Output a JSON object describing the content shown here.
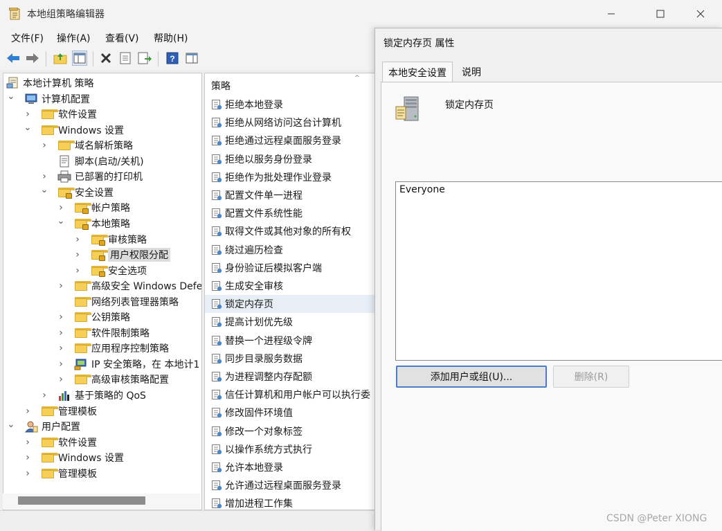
{
  "window": {
    "title": "本地组策略编辑器",
    "minimize_glyph": "—",
    "maximize_glyph": "☐",
    "close_glyph": "✕"
  },
  "menu": [
    "文件(F)",
    "操作(A)",
    "查看(V)",
    "帮助(H)"
  ],
  "toolbar": {
    "icons": [
      "back-arrow-icon",
      "forward-arrow-icon",
      "up-folder-icon",
      "show-hide-tree-icon",
      "delete-icon",
      "properties-icon",
      "export-list-icon",
      "help-icon",
      "action-pane-icon"
    ]
  },
  "tree": {
    "items": [
      {
        "label": "本地计算机 策略",
        "icon": "computer-policy-icon",
        "level": 0,
        "expander": ""
      },
      {
        "label": "计算机配置",
        "icon": "computer-icon",
        "level": 1,
        "expander": "expanded"
      },
      {
        "label": "软件设置",
        "icon": "folder-icon",
        "level": 2,
        "expander": "collapsed"
      },
      {
        "label": "Windows 设置",
        "icon": "folder-icon",
        "level": 2,
        "expander": "expanded"
      },
      {
        "label": "域名解析策略",
        "icon": "folder-icon",
        "level": 3,
        "expander": "collapsed"
      },
      {
        "label": "脚本(启动/关机)",
        "icon": "script-icon",
        "level": 3,
        "expander": ""
      },
      {
        "label": "已部署的打印机",
        "icon": "printer-icon",
        "level": 3,
        "expander": "collapsed"
      },
      {
        "label": "安全设置",
        "icon": "security-folder-icon",
        "level": 3,
        "expander": "expanded"
      },
      {
        "label": "帐户策略",
        "icon": "security-folder-icon",
        "level": 4,
        "expander": "collapsed"
      },
      {
        "label": "本地策略",
        "icon": "security-folder-icon",
        "level": 4,
        "expander": "expanded"
      },
      {
        "label": "审核策略",
        "icon": "security-folder-icon",
        "level": 5,
        "expander": "collapsed"
      },
      {
        "label": "用户权限分配",
        "icon": "security-folder-icon",
        "level": 5,
        "expander": "collapsed",
        "selected": true
      },
      {
        "label": "安全选项",
        "icon": "security-folder-icon",
        "level": 5,
        "expander": "collapsed"
      },
      {
        "label": "高级安全 Windows Defe",
        "icon": "folder-icon",
        "level": 4,
        "expander": "collapsed"
      },
      {
        "label": "网络列表管理器策略",
        "icon": "folder-icon",
        "level": 4,
        "expander": ""
      },
      {
        "label": "公钥策略",
        "icon": "folder-icon",
        "level": 4,
        "expander": "collapsed"
      },
      {
        "label": "软件限制策略",
        "icon": "folder-icon",
        "level": 4,
        "expander": "collapsed"
      },
      {
        "label": "应用程序控制策略",
        "icon": "folder-icon",
        "level": 4,
        "expander": "collapsed"
      },
      {
        "label": "IP 安全策略，在 本地计1",
        "icon": "ip-security-icon",
        "level": 4,
        "expander": "collapsed"
      },
      {
        "label": "高级审核策略配置",
        "icon": "folder-icon",
        "level": 4,
        "expander": "collapsed"
      },
      {
        "label": "基于策略的 QoS",
        "icon": "qos-chart-icon",
        "level": 3,
        "expander": "collapsed"
      },
      {
        "label": "管理模板",
        "icon": "folder-icon",
        "level": 2,
        "expander": "collapsed"
      },
      {
        "label": "用户配置",
        "icon": "user-icon",
        "level": 1,
        "expander": "expanded"
      },
      {
        "label": "软件设置",
        "icon": "folder-icon",
        "level": 2,
        "expander": "collapsed"
      },
      {
        "label": "Windows 设置",
        "icon": "folder-icon",
        "level": 2,
        "expander": "collapsed"
      },
      {
        "label": "管理模板",
        "icon": "folder-icon",
        "level": 2,
        "expander": "collapsed"
      }
    ]
  },
  "list": {
    "header": "策略",
    "sort_glyph": "^",
    "items": [
      "拒绝本地登录",
      "拒绝从网络访问这台计算机",
      "拒绝通过远程桌面服务登录",
      "拒绝以服务身份登录",
      "拒绝作为批处理作业登录",
      "配置文件单一进程",
      "配置文件系统性能",
      "取得文件或其他对象的所有权",
      "绕过遍历检查",
      "身份验证后模拟客户端",
      "生成安全审核",
      "锁定内存页",
      "提高计划优先级",
      "替换一个进程级令牌",
      "同步目录服务数据",
      "为进程调整内存配额",
      "信任计算机和用户帐户可以执行委",
      "修改固件环境值",
      "修改一个对象标签",
      "以操作系统方式执行",
      "允许本地登录",
      "允许通过远程桌面服务登录",
      "增加进程工作集"
    ],
    "highlighted": "锁定内存页"
  },
  "dialog": {
    "title": "锁定内存页 属性",
    "tabs": [
      "本地安全设置",
      "说明"
    ],
    "policy_name": "锁定内存页",
    "accounts": [
      "Everyone"
    ],
    "add_button": "添加用户或组(U)...",
    "remove_button": "删除(R)"
  },
  "watermark": "CSDN @Peter XIONG"
}
